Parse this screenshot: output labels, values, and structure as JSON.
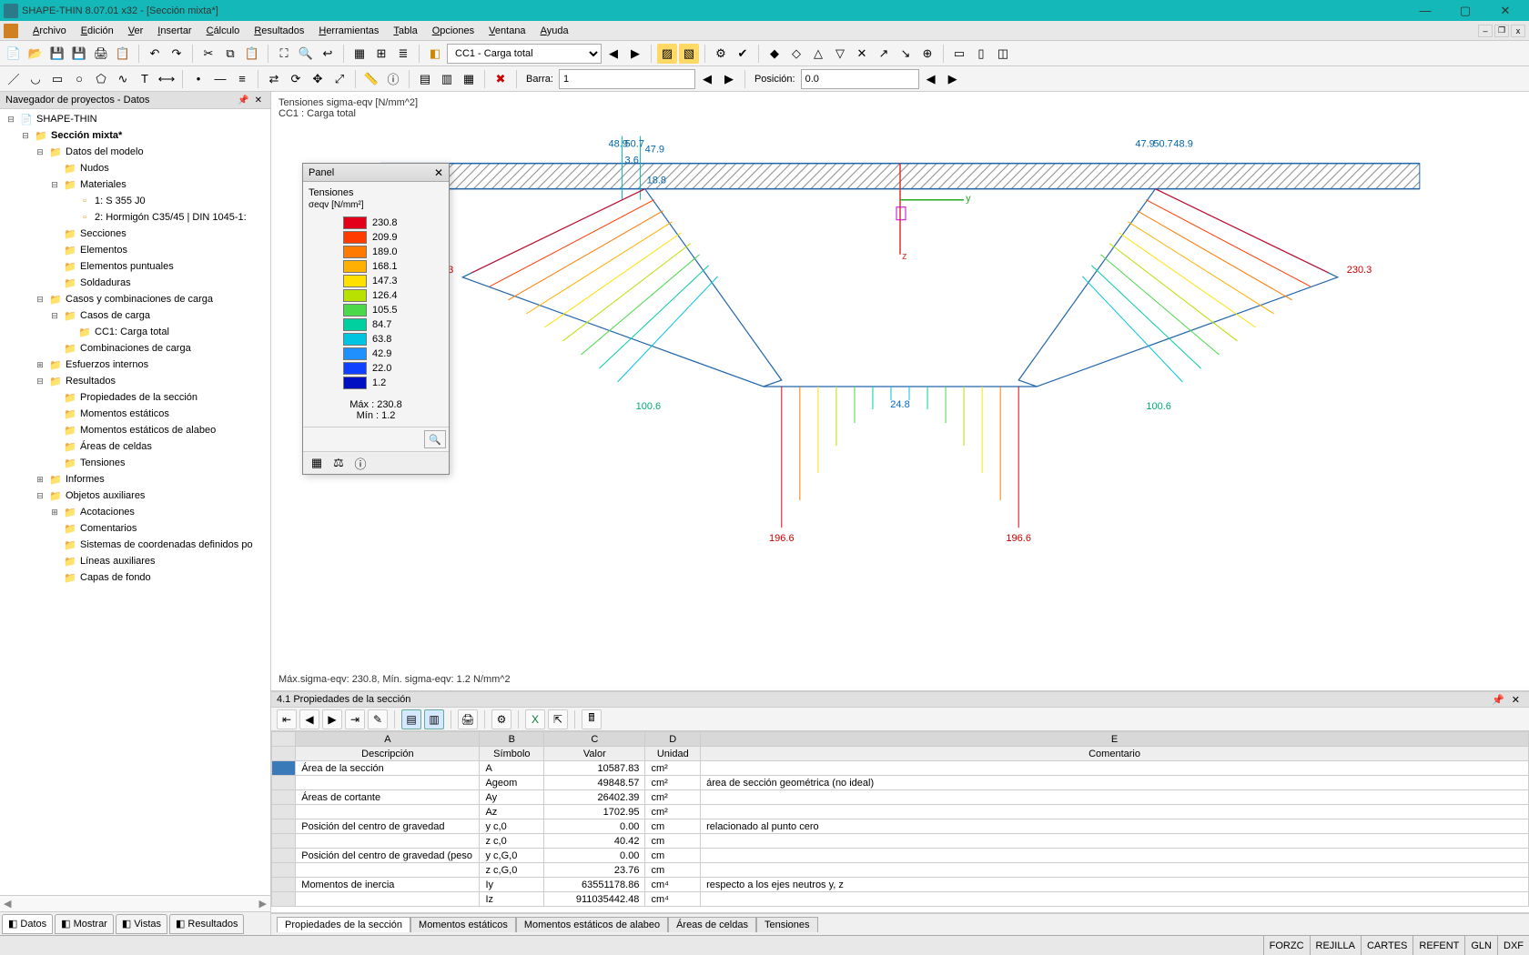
{
  "app": {
    "title": "SHAPE-THIN 8.07.01 x32 - [Sección mixta*]"
  },
  "menu": {
    "items": [
      "Archivo",
      "Edición",
      "Ver",
      "Insertar",
      "Cálculo",
      "Resultados",
      "Herramientas",
      "Tabla",
      "Opciones",
      "Ventana",
      "Ayuda"
    ]
  },
  "toolbar1": {
    "case_select": "CC1 - Carga total"
  },
  "toolbar2": {
    "barra_label": "Barra:",
    "barra_value": "1",
    "posicion_label": "Posición:",
    "posicion_value": "0.0"
  },
  "navigator": {
    "title": "Navegador de proyectos - Datos",
    "root": "SHAPE-THIN",
    "project": "Sección mixta*",
    "tree": [
      {
        "indent": 0,
        "toggle": "-",
        "icon": "📄",
        "label": "SHAPE-THIN"
      },
      {
        "indent": 1,
        "toggle": "-",
        "icon": "📁",
        "label": "Sección mixta*",
        "bold": true
      },
      {
        "indent": 2,
        "toggle": "-",
        "icon": "📁",
        "label": "Datos del modelo"
      },
      {
        "indent": 3,
        "toggle": "",
        "icon": "📁",
        "label": "Nudos"
      },
      {
        "indent": 3,
        "toggle": "-",
        "icon": "📁",
        "label": "Materiales"
      },
      {
        "indent": 4,
        "toggle": "",
        "icon": "▫",
        "label": "1: S 355 J0"
      },
      {
        "indent": 4,
        "toggle": "",
        "icon": "▫",
        "label": "2: Hormigón C35/45 | DIN 1045-1:"
      },
      {
        "indent": 3,
        "toggle": "",
        "icon": "📁",
        "label": "Secciones"
      },
      {
        "indent": 3,
        "toggle": "",
        "icon": "📁",
        "label": "Elementos"
      },
      {
        "indent": 3,
        "toggle": "",
        "icon": "📁",
        "label": "Elementos puntuales"
      },
      {
        "indent": 3,
        "toggle": "",
        "icon": "📁",
        "label": "Soldaduras"
      },
      {
        "indent": 2,
        "toggle": "-",
        "icon": "📁",
        "label": "Casos y combinaciones de carga"
      },
      {
        "indent": 3,
        "toggle": "-",
        "icon": "📁",
        "label": "Casos de carga"
      },
      {
        "indent": 4,
        "toggle": "",
        "icon": "📁",
        "label": "CC1: Carga total"
      },
      {
        "indent": 3,
        "toggle": "",
        "icon": "📁",
        "label": "Combinaciones de carga"
      },
      {
        "indent": 2,
        "toggle": "+",
        "icon": "📁",
        "label": "Esfuerzos internos"
      },
      {
        "indent": 2,
        "toggle": "-",
        "icon": "📁",
        "label": "Resultados"
      },
      {
        "indent": 3,
        "toggle": "",
        "icon": "📁",
        "label": "Propiedades de la sección"
      },
      {
        "indent": 3,
        "toggle": "",
        "icon": "📁",
        "label": "Momentos estáticos"
      },
      {
        "indent": 3,
        "toggle": "",
        "icon": "📁",
        "label": "Momentos estáticos de alabeo"
      },
      {
        "indent": 3,
        "toggle": "",
        "icon": "📁",
        "label": "Áreas de celdas"
      },
      {
        "indent": 3,
        "toggle": "",
        "icon": "📁",
        "label": "Tensiones"
      },
      {
        "indent": 2,
        "toggle": "+",
        "icon": "📁",
        "label": "Informes"
      },
      {
        "indent": 2,
        "toggle": "-",
        "icon": "📁",
        "label": "Objetos auxiliares"
      },
      {
        "indent": 3,
        "toggle": "+",
        "icon": "📁",
        "label": "Acotaciones"
      },
      {
        "indent": 3,
        "toggle": "",
        "icon": "📁",
        "label": "Comentarios"
      },
      {
        "indent": 3,
        "toggle": "",
        "icon": "📁",
        "label": "Sistemas de coordenadas definidos po"
      },
      {
        "indent": 3,
        "toggle": "",
        "icon": "📁",
        "label": "Líneas auxiliares"
      },
      {
        "indent": 3,
        "toggle": "",
        "icon": "📁",
        "label": "Capas de fondo"
      }
    ],
    "tabs": [
      {
        "label": "Datos",
        "active": true
      },
      {
        "label": "Mostrar",
        "active": false
      },
      {
        "label": "Vistas",
        "active": false
      },
      {
        "label": "Resultados",
        "active": false
      }
    ]
  },
  "viewport": {
    "title_line1": "Tensiones sigma-eqv [N/mm^2]",
    "title_line2": "CC1 : Carga total",
    "caption": "Máx.sigma-eqv: 230.8, Mín. sigma-eqv: 1.2 N/mm^2",
    "labels": {
      "left_tip": "234.3",
      "right_tip": "230.3",
      "left_low": "100.6",
      "right_low": "100.6",
      "center": "24.8",
      "bottom_left": "196.6",
      "bottom_right": "196.6",
      "top_l1": "48.9",
      "top_l2": "50.7",
      "top_l3": "47.9",
      "top_l4": "3.6",
      "top_l5": "18.8",
      "top_r1": "47.9",
      "top_r2": "50.7",
      "top_r3": "48.9"
    }
  },
  "panel": {
    "title": "Panel",
    "sub": "Tensiones",
    "units": "σeqv [N/mm²]",
    "legend": [
      {
        "c": "#e2001a",
        "v": "230.8"
      },
      {
        "c": "#ff3b00",
        "v": "209.9"
      },
      {
        "c": "#ff7a00",
        "v": "189.0"
      },
      {
        "c": "#ffb000",
        "v": "168.1"
      },
      {
        "c": "#ffe000",
        "v": "147.3"
      },
      {
        "c": "#b8e000",
        "v": "126.4"
      },
      {
        "c": "#4bd84b",
        "v": "105.5"
      },
      {
        "c": "#00d0a0",
        "v": "84.7"
      },
      {
        "c": "#00c4e0",
        "v": "63.8"
      },
      {
        "c": "#2090ff",
        "v": "42.9"
      },
      {
        "c": "#1040ff",
        "v": "22.0"
      },
      {
        "c": "#0010c0",
        "v": "1.2"
      }
    ],
    "max_label": "Máx  :  230.8",
    "min_label": "Mín   :      1.2"
  },
  "results": {
    "header": "4.1 Propiedades de la sección",
    "col_letters": [
      "A",
      "B",
      "C",
      "D",
      "E"
    ],
    "col_heads": [
      "Descripción",
      "Símbolo",
      "Valor",
      "Unidad",
      "Comentario"
    ],
    "rows": [
      {
        "sel": true,
        "d": "Área de la sección",
        "s": "A",
        "v": "10587.83",
        "u": "cm²",
        "c": ""
      },
      {
        "sel": false,
        "d": "",
        "s": "Ageom",
        "v": "49848.57",
        "u": "cm²",
        "c": "área de sección geométrica (no ideal)"
      },
      {
        "sel": false,
        "d": "Áreas de cortante",
        "s": "Ay",
        "v": "26402.39",
        "u": "cm²",
        "c": ""
      },
      {
        "sel": false,
        "d": "",
        "s": "Az",
        "v": "1702.95",
        "u": "cm²",
        "c": ""
      },
      {
        "sel": false,
        "d": "Posición del centro de gravedad",
        "s": "y c,0",
        "v": "0.00",
        "u": "cm",
        "c": "relacionado al punto cero"
      },
      {
        "sel": false,
        "d": "",
        "s": "z c,0",
        "v": "40.42",
        "u": "cm",
        "c": ""
      },
      {
        "sel": false,
        "d": "Posición del centro de gravedad (peso",
        "s": "y c,G,0",
        "v": "0.00",
        "u": "cm",
        "c": ""
      },
      {
        "sel": false,
        "d": "",
        "s": "z c,G,0",
        "v": "23.76",
        "u": "cm",
        "c": ""
      },
      {
        "sel": false,
        "d": "Momentos de inercia",
        "s": "Iy",
        "v": "63551178.86",
        "u": "cm⁴",
        "c": "respecto a los ejes neutros y, z"
      },
      {
        "sel": false,
        "d": "",
        "s": "Iz",
        "v": "911035442.48",
        "u": "cm⁴",
        "c": ""
      }
    ],
    "tabs": [
      "Propiedades de la sección",
      "Momentos estáticos",
      "Momentos estáticos de alabeo",
      "Áreas de celdas",
      "Tensiones"
    ],
    "active_tab": 0
  },
  "statusbar": {
    "cells": [
      "FORZC",
      "REJILLA",
      "CARTES",
      "REFENT",
      "GLN",
      "DXF"
    ]
  }
}
